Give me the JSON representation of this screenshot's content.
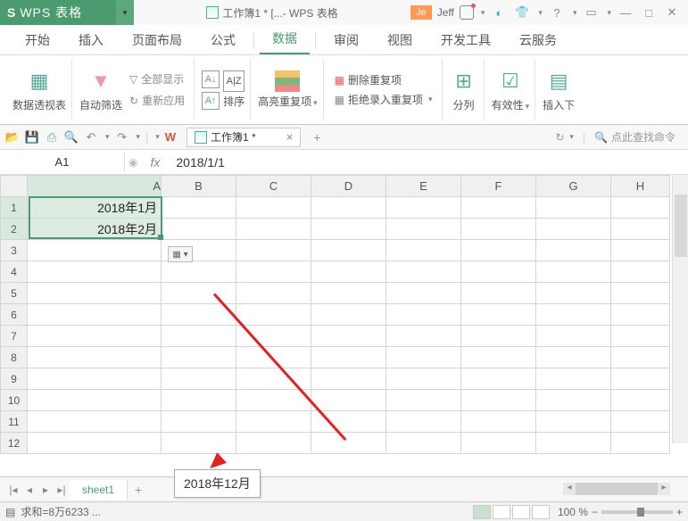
{
  "title": {
    "app": "WPS 表格",
    "doc_icon": "sheet",
    "doc": "工作簿1 * [...- WPS 表格"
  },
  "user": {
    "badge": "Je",
    "name": "Jeff"
  },
  "win": {
    "min": "—",
    "max": "□",
    "close": "✕"
  },
  "tabs": [
    "开始",
    "插入",
    "页面布局",
    "公式",
    "数据",
    "审阅",
    "视图",
    "开发工具",
    "云服务"
  ],
  "active_tab": 4,
  "ribbon": {
    "pivot": "数据透视表",
    "autofilter": "自动筛选",
    "showall": "全部显示",
    "reapply": "重新应用",
    "sort": "排序",
    "highlight": "高亮重复项",
    "removedup": "删除重复项",
    "rejectdup": "拒绝录入重复项",
    "split": "分列",
    "validity": "有效性",
    "insert": "插入下"
  },
  "docTab": {
    "name": "工作簿1 *"
  },
  "cmd_search": "点此查找命令",
  "fbar": {
    "cellref": "A1",
    "fx": "fx",
    "value": "2018/1/1"
  },
  "cols": [
    "A",
    "B",
    "C",
    "D",
    "E",
    "F",
    "G",
    "H"
  ],
  "rows": [
    1,
    2,
    3,
    4,
    5,
    6,
    7,
    8,
    9,
    10,
    11,
    12
  ],
  "cells": {
    "A1": "2018年1月",
    "A2": "2018年2月"
  },
  "autofill_opt": "▦ ▾",
  "tooltip": "2018年12月",
  "sheet": "sheet1",
  "status": {
    "sum": "求和=8万6233 ...",
    "zoom": "100 %"
  }
}
